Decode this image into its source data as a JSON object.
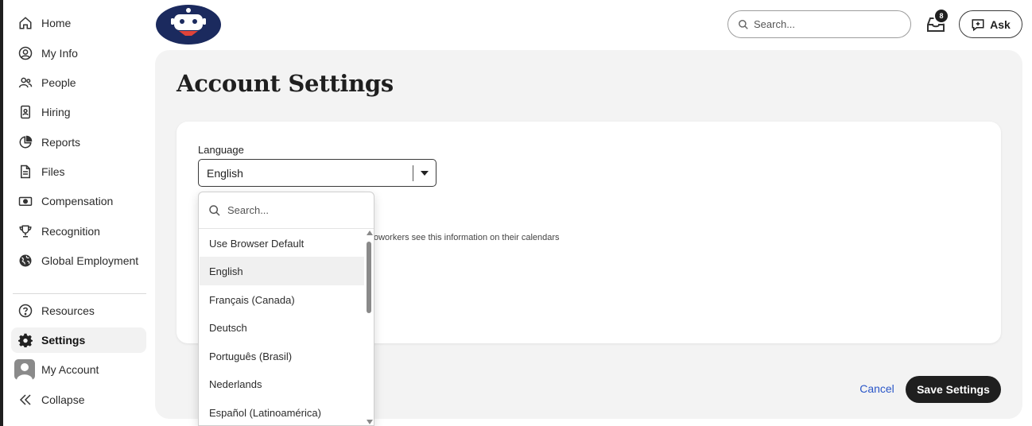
{
  "sidebar": {
    "items": [
      {
        "label": "Home",
        "icon": "home-icon"
      },
      {
        "label": "My Info",
        "icon": "user-circle-icon"
      },
      {
        "label": "People",
        "icon": "people-icon"
      },
      {
        "label": "Hiring",
        "icon": "id-badge-icon"
      },
      {
        "label": "Reports",
        "icon": "pie-chart-icon"
      },
      {
        "label": "Files",
        "icon": "file-icon"
      },
      {
        "label": "Compensation",
        "icon": "money-icon"
      },
      {
        "label": "Recognition",
        "icon": "trophy-icon"
      },
      {
        "label": "Global Employment",
        "icon": "globe-icon"
      }
    ],
    "bottom_items": [
      {
        "label": "Resources",
        "icon": "help-circle-icon"
      },
      {
        "label": "Settings",
        "icon": "gear-icon",
        "active": true
      },
      {
        "label": "My Account",
        "icon": "avatar-icon"
      },
      {
        "label": "Collapse",
        "icon": "double-chevron-left-icon"
      }
    ]
  },
  "header": {
    "search_placeholder": "Search...",
    "notification_count": "8",
    "ask_label": "Ask"
  },
  "page": {
    "title": "Account Settings",
    "language_label": "Language",
    "language_value": "English",
    "helper_text": "oworkers see this information on their calendars",
    "cancel_label": "Cancel",
    "save_label": "Save Settings"
  },
  "dropdown": {
    "search_placeholder": "Search...",
    "options": [
      "Use Browser Default",
      "English",
      "Français (Canada)",
      "Deutsch",
      "Português (Brasil)",
      "Nederlands",
      "Español (Latinoamérica)"
    ],
    "selected": "English"
  },
  "colors": {
    "accent_dark": "#1f1f1f",
    "link_blue": "#2b57c8",
    "panel_bg": "#f3f3f3",
    "logo_navy": "#1b2a5e",
    "logo_red": "#e0443a"
  }
}
